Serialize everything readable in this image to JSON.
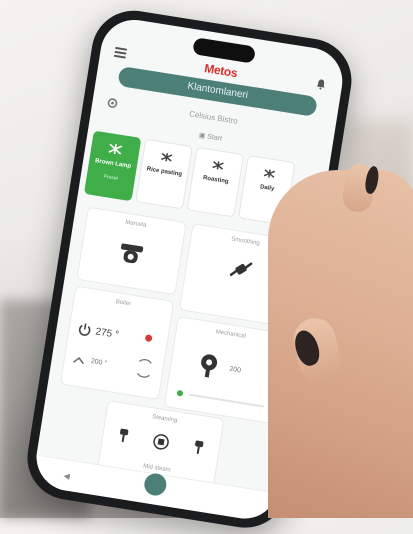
{
  "app": {
    "brand": "Metos",
    "header_title": "Klantomlaneri",
    "subtitle": "Celsius Bistro",
    "camera_label": "Start"
  },
  "modes": [
    {
      "label": "Brown Lamp",
      "sub": "Preset",
      "active": true
    },
    {
      "label": "Rice pasting",
      "sub": "",
      "active": false
    },
    {
      "label": "Roasting",
      "sub": "",
      "active": false
    },
    {
      "label": "Daily",
      "sub": "",
      "active": false
    }
  ],
  "tiles": {
    "top_left": {
      "title": "Marcela",
      "sub": ""
    },
    "top_right": {
      "title": "Smoothing",
      "sub": ""
    },
    "mid_left": {
      "title": "Boiler",
      "sub": "",
      "temp_main": "275 °",
      "temp_small": "200 °"
    },
    "mid_right": {
      "title": "Mechanical",
      "sub": "",
      "value": "200"
    },
    "bottom": {
      "title": "Steaming",
      "sub": "",
      "footer": "Mid steam"
    }
  },
  "colors": {
    "accent_teal": "#4d7f79",
    "active_green": "#3fae49",
    "brand_red": "#d62f2f",
    "status_red": "#d83a3a"
  }
}
